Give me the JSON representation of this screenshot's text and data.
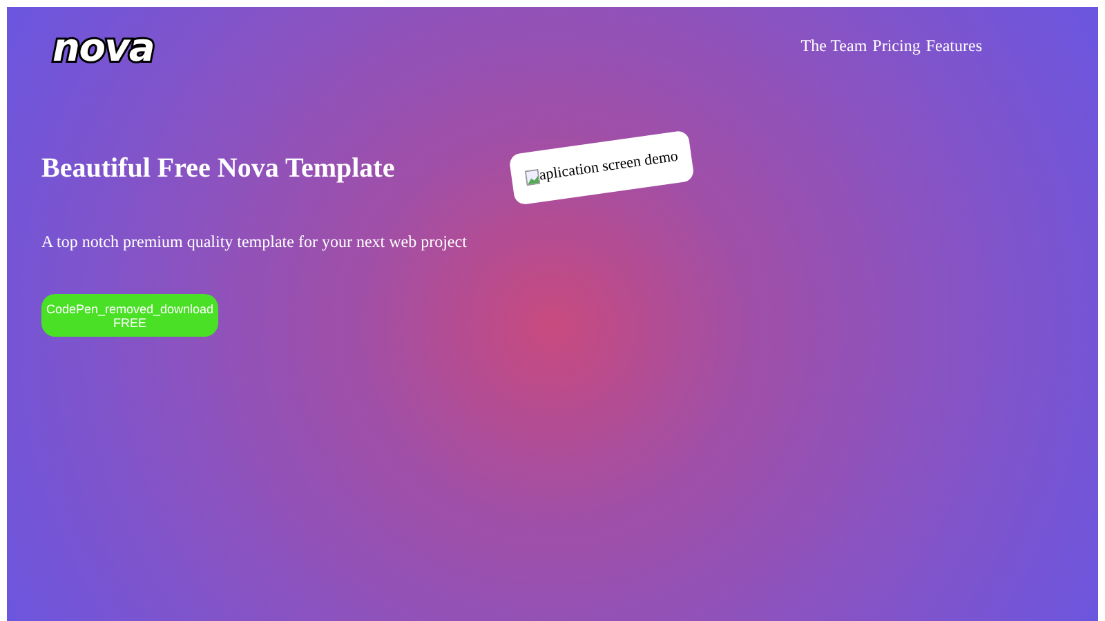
{
  "logo": "nova",
  "nav": [
    {
      "label": "The Team"
    },
    {
      "label": "Pricing"
    },
    {
      "label": "Features"
    }
  ],
  "hero": {
    "title": "Beautiful Free Nova Template",
    "subtitle": "A top notch premium quality template for your next web project",
    "button": "CodePen_removed_download FREE"
  },
  "image": {
    "alt": "aplication screen demo"
  }
}
